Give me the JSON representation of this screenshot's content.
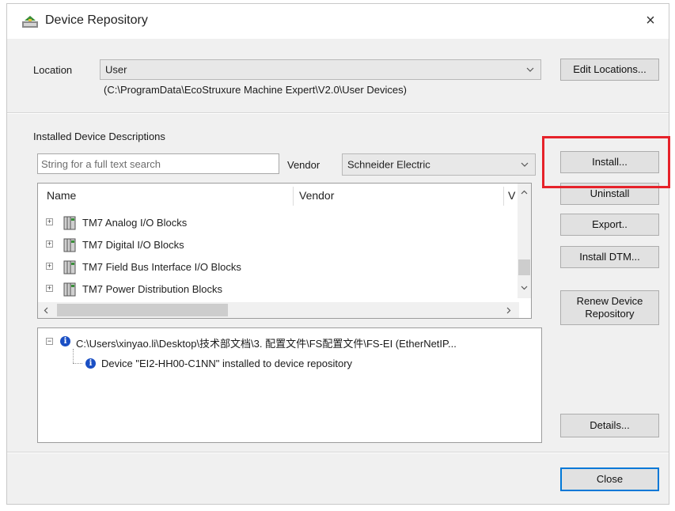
{
  "window": {
    "title": "Device Repository",
    "close_glyph": "×"
  },
  "location": {
    "label": "Location",
    "value": "User",
    "path": "(C:\\ProgramData\\EcoStruxure Machine Expert\\V2.0\\User Devices)",
    "edit_button": "Edit Locations..."
  },
  "installed": {
    "section_label": "Installed Device Descriptions",
    "search_placeholder": "String for a full text search",
    "vendor_label": "Vendor",
    "vendor_value": "Schneider Electric",
    "columns": {
      "name": "Name",
      "vendor": "Vendor",
      "version": "V"
    },
    "rows": [
      {
        "label": "TM7 Analog I/O Blocks"
      },
      {
        "label": "TM7 Digital I/O Blocks"
      },
      {
        "label": "TM7 Field Bus Interface I/O Blocks"
      },
      {
        "label": "TM7 Power Distribution Blocks"
      }
    ]
  },
  "buttons": {
    "install": "Install...",
    "uninstall": "Uninstall",
    "export": "Export..",
    "install_dtm": "Install DTM...",
    "renew": "Renew Device Repository",
    "details": "Details...",
    "close": "Close"
  },
  "messages": {
    "parent": "C:\\Users\\xinyao.li\\Desktop\\技术部文档\\3. 配置文件\\FS配置文件\\FS-EI (EtherNetIP...",
    "child": "Device \"EI2-HH00-C1NN\" installed to device repository"
  },
  "colors": {
    "highlight": "#e6222a",
    "info": "#1a4fc4",
    "default_button_border": "#0078d7"
  }
}
